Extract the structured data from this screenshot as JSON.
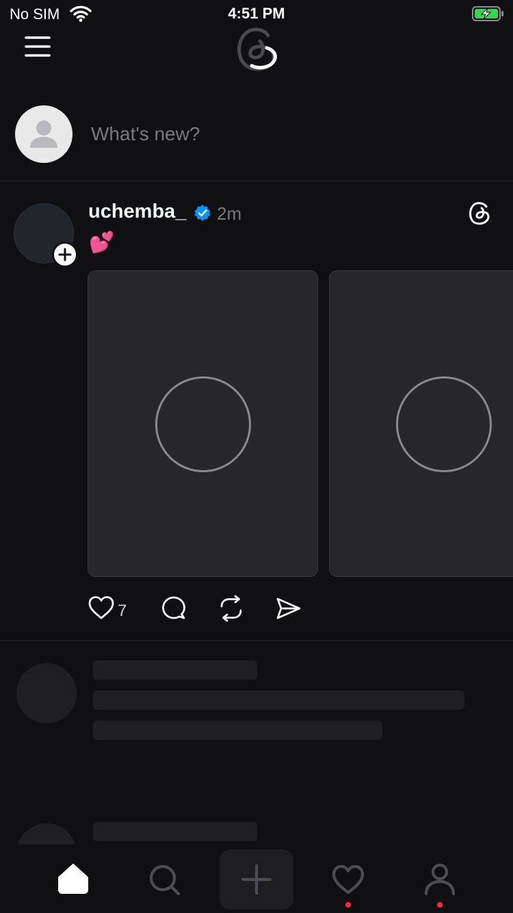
{
  "status_bar": {
    "carrier": "No SIM",
    "time": "4:51 PM",
    "battery_charging": true,
    "battery_color": "#32d74b"
  },
  "header": {
    "menu_icon": "hamburger-menu-icon",
    "logo_icon": "threads-logo-icon"
  },
  "composer": {
    "placeholder": "What's new?",
    "avatar_icon": "default-user-avatar-icon"
  },
  "post": {
    "username": "uchemba_",
    "verified": true,
    "verified_color": "#0095f6",
    "time": "2m",
    "text": "💕",
    "media_count": 2,
    "media_state": "loading",
    "actions": {
      "like_count": "7",
      "like_icon": "heart-icon",
      "reply_icon": "comment-bubble-icon",
      "repost_icon": "repost-icon",
      "share_icon": "send-icon"
    }
  },
  "bottom_nav": {
    "items": [
      {
        "id": "home",
        "icon": "home-icon",
        "active": true
      },
      {
        "id": "search",
        "icon": "search-icon",
        "active": false
      },
      {
        "id": "create",
        "icon": "plus-icon",
        "active": false
      },
      {
        "id": "activity",
        "icon": "heart-icon",
        "active": false,
        "badge": true
      },
      {
        "id": "profile",
        "icon": "person-icon",
        "active": false,
        "badge": true
      }
    ],
    "badge_color": "#ff2a48"
  }
}
